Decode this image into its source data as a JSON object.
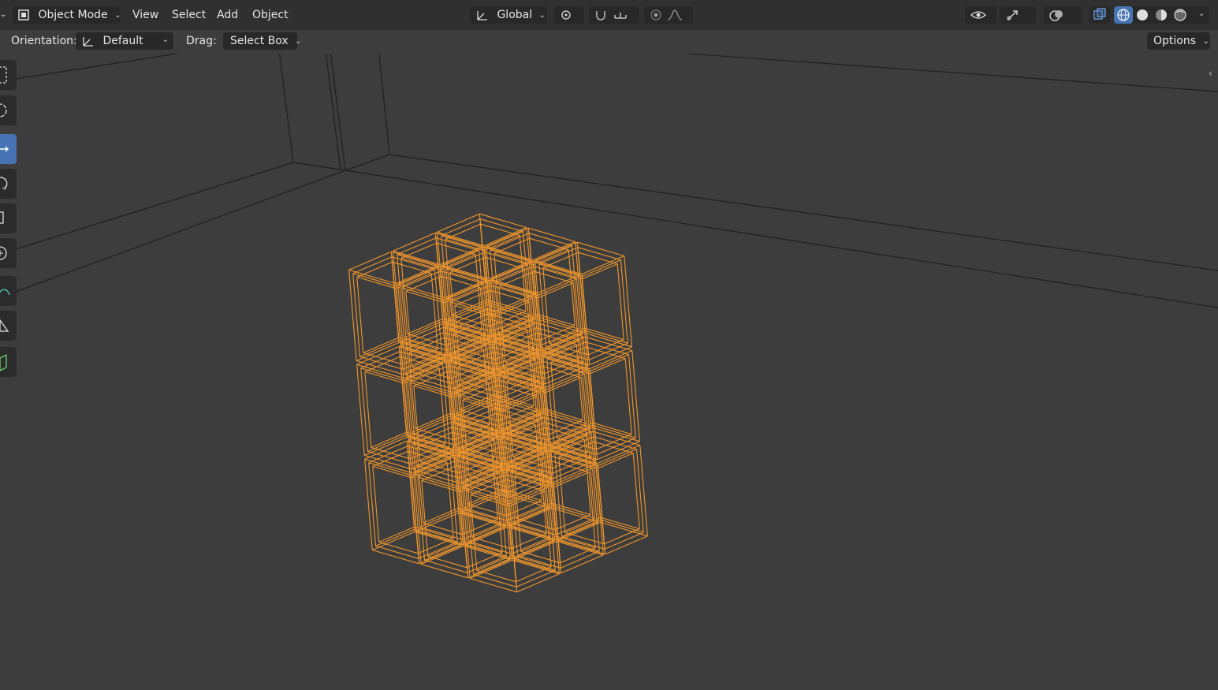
{
  "header": {
    "mode_label": "Object Mode",
    "menus": [
      "View",
      "Select",
      "Add",
      "Object"
    ],
    "transform_orientation": "Global",
    "options_label": "Options"
  },
  "tool_settings": {
    "orientation_label": "Orientation:",
    "orientation_value": "Default",
    "drag_label": "Drag:",
    "drag_value": "Select Box"
  },
  "toolbar": {
    "tools": [
      "select-box",
      "cursor",
      "move",
      "rotate",
      "scale",
      "transform",
      "annotate",
      "measure",
      "add-cube"
    ],
    "active_tool": "move"
  },
  "viewport": {
    "shading": "wireframe",
    "selection_color": "#f0962d",
    "object_grid": "3x3x3"
  },
  "colors": {
    "header_bg": "#303030",
    "viewport_bg": "#3d3d3d",
    "active_blue": "#4772b3",
    "selection_orange": "#f0962d"
  }
}
